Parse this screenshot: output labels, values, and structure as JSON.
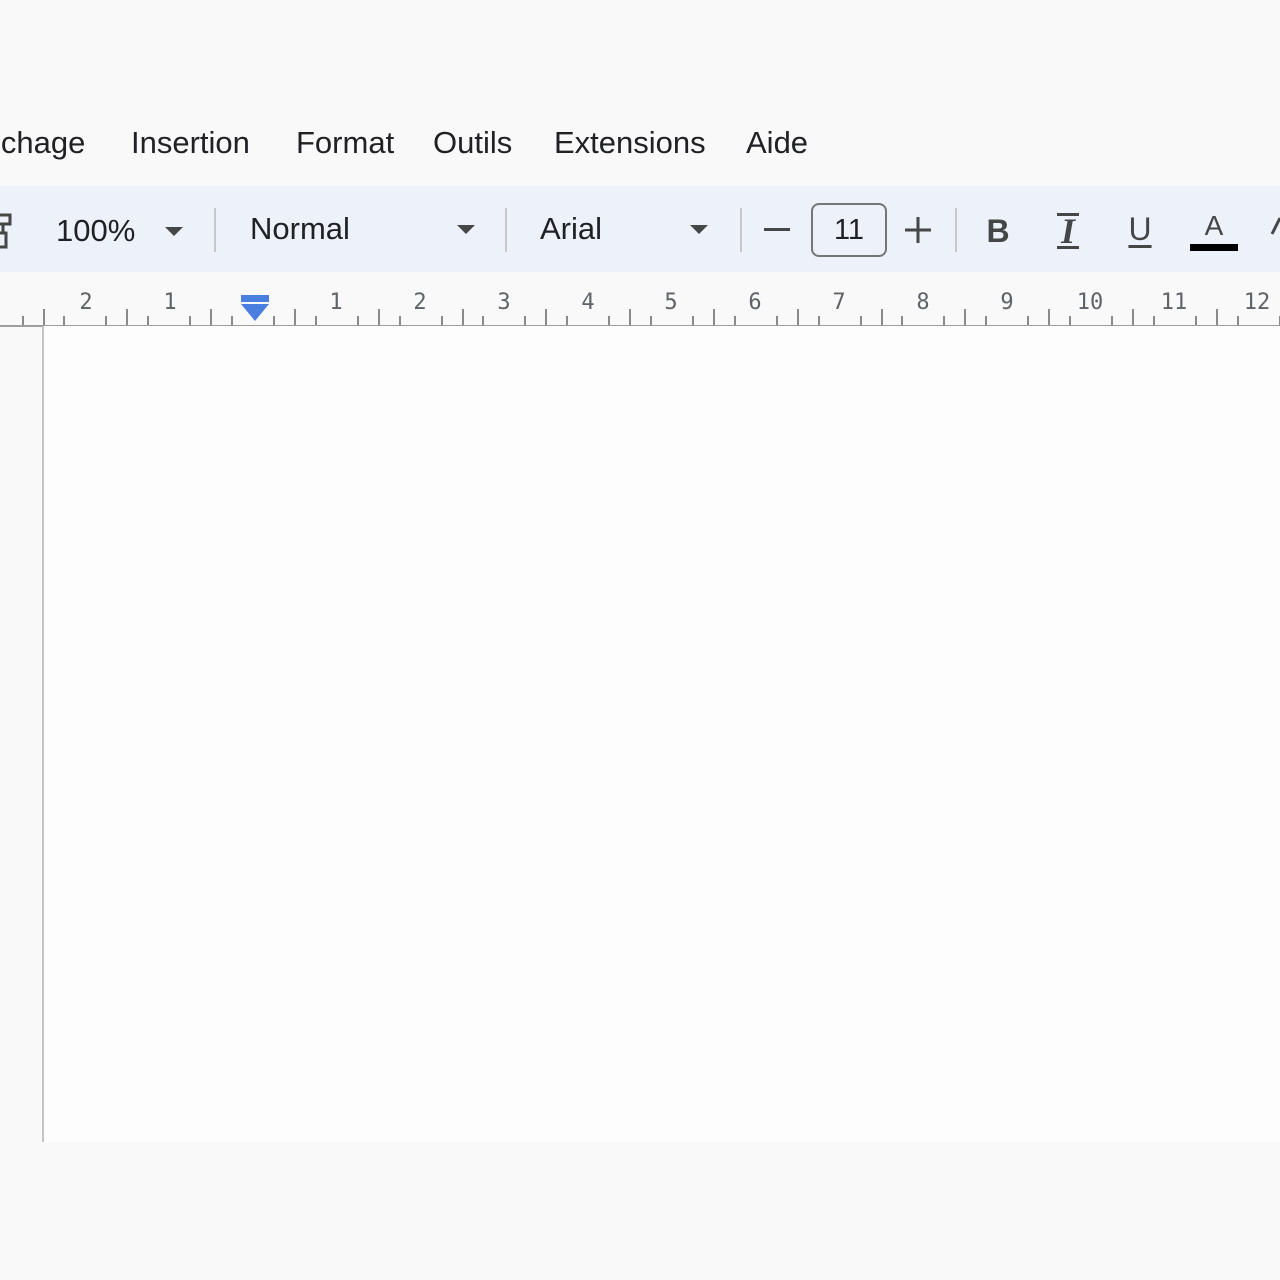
{
  "menu": {
    "items": [
      {
        "label": "ichage"
      },
      {
        "label": "Insertion"
      },
      {
        "label": "Format"
      },
      {
        "label": "Outils"
      },
      {
        "label": "Extensions"
      },
      {
        "label": "Aide"
      }
    ]
  },
  "toolbar": {
    "zoom": "100%",
    "paragraph_style": "Normal",
    "font": "Arial",
    "font_size": "11",
    "decrease_label": "–",
    "increase_label": "+",
    "bold_label": "B",
    "italic_label": "I",
    "underline_label": "U",
    "text_color_label": "A",
    "text_color": "#000000"
  },
  "ruler": {
    "left_numbers": [
      "2",
      "1"
    ],
    "right_numbers": [
      "1",
      "2",
      "3",
      "4",
      "5",
      "6",
      "7",
      "8",
      "9",
      "10",
      "11",
      "12"
    ],
    "indent_marker_color": "#4a7fe0"
  },
  "icons": {
    "print_layout": "print-layout-icon",
    "dropdown": "chevron-down-icon"
  }
}
